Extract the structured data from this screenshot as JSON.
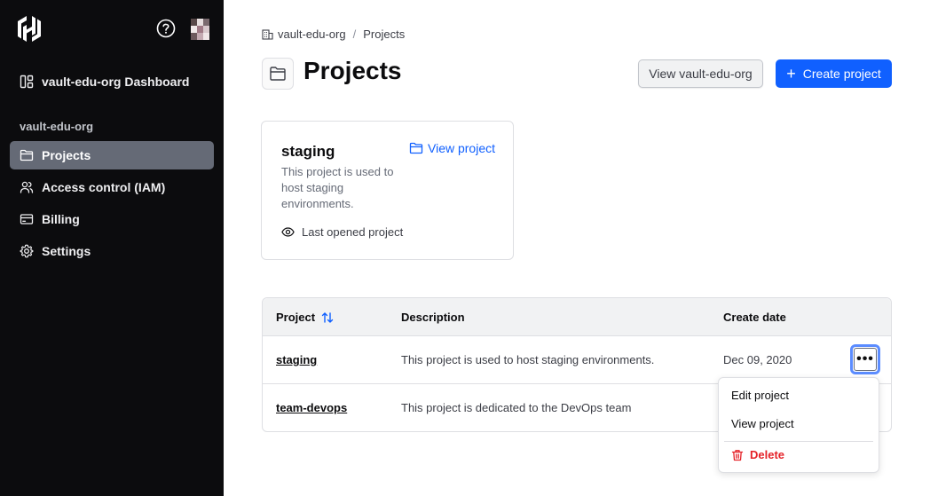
{
  "colors": {
    "sidebar_bg": "#0c0c0e",
    "active_item": "#656a76",
    "primary": "#1060ff",
    "danger": "#e52228"
  },
  "sidebar": {
    "dashboard_label": "vault-edu-org Dashboard",
    "org_label": "vault-edu-org",
    "items": [
      {
        "label": "Projects",
        "icon": "folder-icon",
        "active": true
      },
      {
        "label": "Access control (IAM)",
        "icon": "users-icon"
      },
      {
        "label": "Billing",
        "icon": "credit-card-icon"
      },
      {
        "label": "Settings",
        "icon": "gear-icon"
      }
    ]
  },
  "breadcrumb": {
    "org": "vault-edu-org",
    "separator": "/",
    "current": "Projects"
  },
  "header": {
    "title": "Projects",
    "view_org_button": "View vault-edu-org",
    "create_button": "Create project"
  },
  "card": {
    "title": "staging",
    "view_link": "View project",
    "description": "This project is used to host staging environments.",
    "last_opened": "Last opened project"
  },
  "table": {
    "columns": [
      "Project",
      "Description",
      "Create date"
    ],
    "rows": [
      {
        "name": "staging",
        "description": "This project is used to host staging environments.",
        "date": "Dec 09, 2020"
      },
      {
        "name": "team-devops",
        "description": "This project is dedicated to the DevOps team",
        "date": ""
      }
    ]
  },
  "dropdown": {
    "edit": "Edit project",
    "view": "View project",
    "delete": "Delete"
  }
}
